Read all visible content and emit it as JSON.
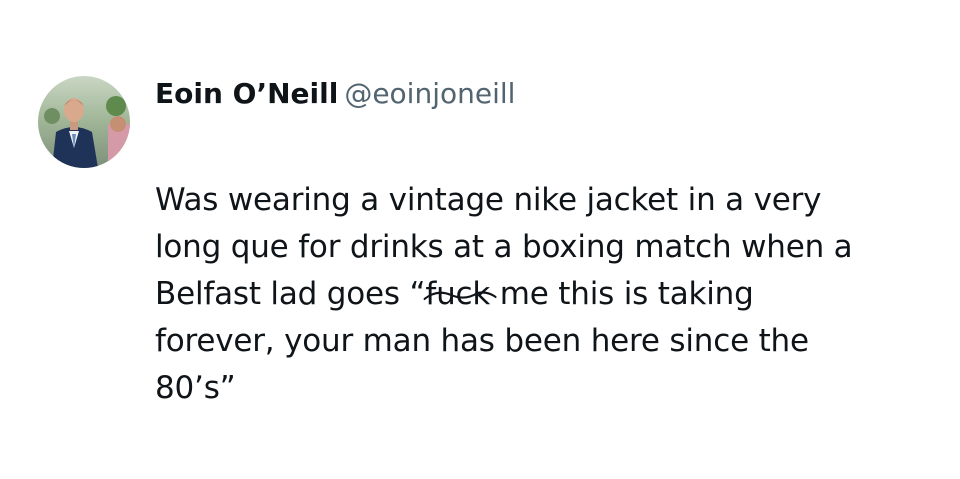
{
  "author": {
    "display_name": "Eoin O’Neill",
    "handle": "@eoinjoneill",
    "avatar_icon": "profile-photo"
  },
  "tweet": {
    "line1": "Was wearing a vintage nike jacket in a very",
    "line2": "long que for drinks at a boxing match when a",
    "line3_before": "Belfast lad goes “",
    "line3_struck": "fuck",
    "line3_after": " me this is taking",
    "line4": "forever, your man has been here since the",
    "line5": "80’s”"
  },
  "colors": {
    "text": "#0f1419",
    "handle": "#536471",
    "background": "#ffffff"
  }
}
